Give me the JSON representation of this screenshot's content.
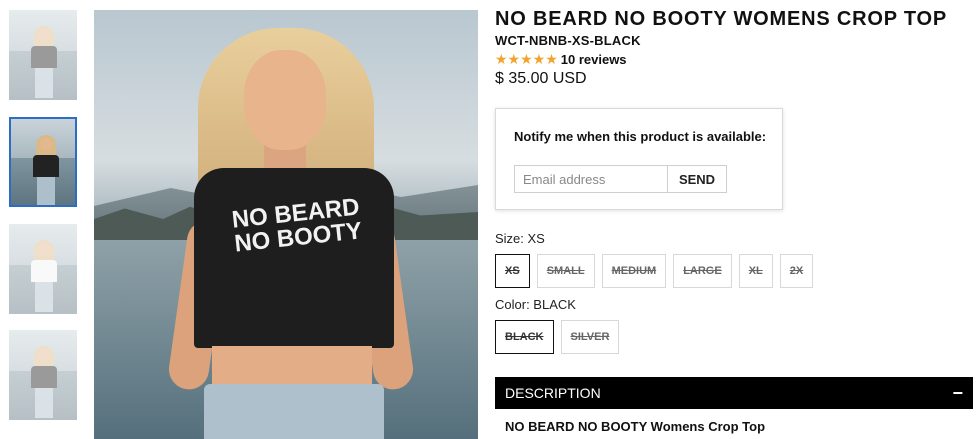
{
  "product": {
    "title": "NO BEARD NO BOOTY WOMENS CROP TOP",
    "sku": "WCT-NBNB-XS-BLACK",
    "rating_stars": "★★★★★",
    "rating_value": 5,
    "reviews": "10 reviews",
    "price": "$ 35.00 USD",
    "shirt_print": "NO BEARD NO BOOTY"
  },
  "notify": {
    "title": "Notify me when this product is available:",
    "email_placeholder": "Email address",
    "send_label": "SEND"
  },
  "size": {
    "label": "Size: XS",
    "options": [
      "XS",
      "SMALL",
      "MEDIUM",
      "LARGE",
      "XL",
      "2X"
    ],
    "selected": "XS"
  },
  "color": {
    "label": "Color: BLACK",
    "options": [
      "BLACK",
      "SILVER"
    ],
    "selected": "BLACK"
  },
  "description": {
    "header": "DESCRIPTION",
    "toggle": "−",
    "text": "NO BEARD NO BOOTY Womens Crop Top"
  },
  "colors": {
    "star": "#f2a32b",
    "thumb_active_border": "#2b6cc4",
    "desc_bar": "#000000"
  }
}
